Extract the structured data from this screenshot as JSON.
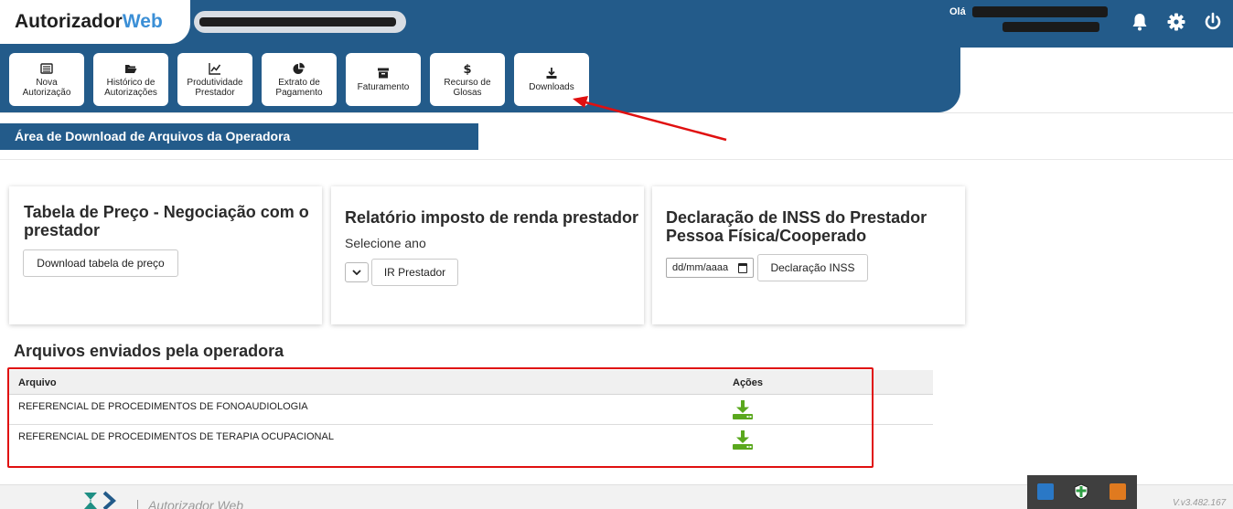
{
  "header": {
    "logo_part1": "Autorizador",
    "logo_part2": "Web",
    "greeting": "Olá",
    "colors": {
      "primary": "#235b8a",
      "accent": "#3b8fd6",
      "download_green": "#5aa81d",
      "highlight_red": "#e01010"
    }
  },
  "nav": {
    "items": [
      {
        "icon": "list-icon",
        "line1": "Nova",
        "line2": "Autorização"
      },
      {
        "icon": "folder-open-icon",
        "line1": "Histórico de",
        "line2": "Autorizações"
      },
      {
        "icon": "line-chart-icon",
        "line1": "Produtividade",
        "line2": "Prestador"
      },
      {
        "icon": "pie-chart-icon",
        "line1": "Extrato de",
        "line2": "Pagamento"
      },
      {
        "icon": "archive-icon",
        "line1": "Faturamento",
        "line2": ""
      },
      {
        "icon": "dollar-icon",
        "line1": "Recurso de",
        "line2": "Glosas"
      },
      {
        "icon": "download-icon",
        "line1": "Downloads",
        "line2": ""
      }
    ]
  },
  "section": {
    "title": "Área de Download de Arquivos da Operadora"
  },
  "cards": {
    "price": {
      "title": "Tabela de Preço - Negociação com o prestador",
      "button": "Download tabela de preço"
    },
    "ir": {
      "title": "Relatório imposto de renda prestador",
      "select_label": "Selecione ano",
      "button": "IR Prestador"
    },
    "inss": {
      "title": "Declaração de INSS do Prestador Pessoa Física/Cooperado",
      "date_placeholder": "dd/mm/aaaa",
      "button": "Declaração INSS"
    }
  },
  "files": {
    "title": "Arquivos enviados pela operadora",
    "col_file": "Arquivo",
    "col_actions": "Ações",
    "rows": [
      {
        "name": "REFERENCIAL DE PROCEDIMENTOS DE FONOAUDIOLOGIA"
      },
      {
        "name": "REFERENCIAL DE PROCEDIMENTOS DE TERAPIA OCUPACIONAL"
      }
    ]
  },
  "footer": {
    "app_name": "Autorizador Web",
    "version": "V.v3.482.167"
  }
}
